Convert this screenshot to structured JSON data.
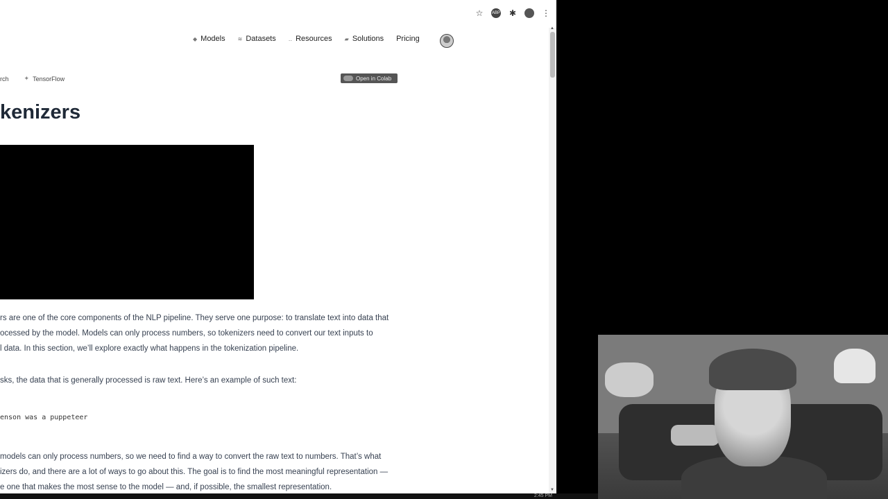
{
  "browser": {
    "toolbar_icons": [
      "star-icon",
      "adblock-icon",
      "extensions-icon",
      "profile-icon",
      "more-menu-icon"
    ],
    "toolbar_adblock_label": "ABP",
    "toolbar_more": "⋮",
    "toolbar_star": "☆",
    "toolbar_puzzle": "✱"
  },
  "nav": {
    "items": [
      {
        "label": "Models",
        "icon": "models-icon"
      },
      {
        "label": "Datasets",
        "icon": "datasets-icon"
      },
      {
        "label": "Resources",
        "icon": "resources-icon"
      },
      {
        "label": "Solutions",
        "icon": "solutions-icon"
      },
      {
        "label": "Pricing"
      }
    ]
  },
  "framework_tabs": {
    "pytorch_partial": "rch",
    "tensorflow": "TensorFlow"
  },
  "colab_button": "Open in Colab",
  "page": {
    "title_partial": "kenizers",
    "paragraph1": [
      "rs are one of the core components of the NLP pipeline. They serve one purpose: to translate text into data that",
      "ocessed by the model. Models can only process numbers, so tokenizers need to convert our text inputs to",
      "l data. In this section, we’ll explore exactly what happens in the tokenization pipeline."
    ],
    "paragraph2": "sks, the data that is generally processed is raw text. Here’s an example of such text:",
    "code_sample": "enson was a puppeteer",
    "paragraph3": [
      " models can only process numbers, so we need to find a way to convert the raw text to numbers. That’s what",
      "izers do, and there are a lot of ways to go about this. The goal is to find the most meaningful representation —",
      "e one that makes the most sense to the model — and, if possible, the smallest representation."
    ]
  },
  "taskbar": {
    "clock": "2:45 PM"
  }
}
